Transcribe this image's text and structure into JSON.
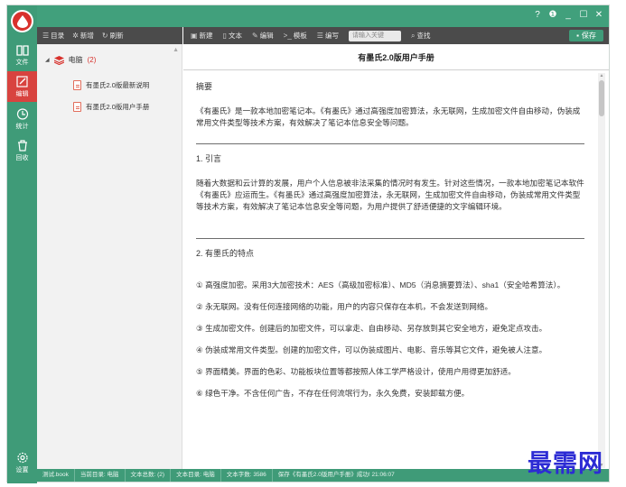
{
  "window": {
    "controls": [
      "?",
      "❶",
      "_",
      "☐",
      "✕"
    ]
  },
  "rail": {
    "items": [
      {
        "label": "文件",
        "icon": "book-icon"
      },
      {
        "label": "编辑",
        "icon": "edit-icon",
        "active": true
      },
      {
        "label": "统计",
        "icon": "clock-icon"
      },
      {
        "label": "回收",
        "icon": "trash-icon"
      }
    ],
    "settings_label": "设置"
  },
  "tree_toolbar": {
    "catalog": "目录",
    "add": "新增",
    "refresh": "刷新"
  },
  "editor_toolbar": {
    "new": "新建",
    "text": "文本",
    "edit": "编辑",
    "template": "模板",
    "format": "编写",
    "search_placeholder": "请输入关键",
    "find": "查找",
    "save": "保存"
  },
  "tree": {
    "root_label": "电脑",
    "root_count": "(2)",
    "nodes": [
      "有墨氏2.0版最新说明",
      "有墨氏2.0版用户手册"
    ]
  },
  "document": {
    "title": "有墨氏2.0版用户手册",
    "heading_abstract": "摘要",
    "abstract": "《有墨氏》是一款本地加密笔记本。《有墨氏》通过高强度加密算法，永无联网，生成加密文件自由移动，伪装成常用文件类型等技术方案，有效解决了笔记本信息安全等问题。",
    "heading_intro": "1. 引言",
    "intro": "随着大数据和云计算的发展，用户个人信息被非法采集的情况时有发生。针对这些情况，一款本地加密笔记本软件《有墨氏》应运而生。《有墨氏》通过高强度加密算法，永无联网，生成加密文件自由移动，伪装成常用文件类型等技术方案，有效解决了笔记本信息安全等问题，为用户提供了舒适便捷的文字编辑环境。",
    "heading_features": "2. 有墨氏的特点",
    "features": [
      "① 高强度加密。采用3大加密技术：AES（高级加密标准）、MD5（消息摘要算法）、sha1（安全哈希算法）。",
      "② 永无联网。没有任何连接网络的功能，用户的内容只保存在本机，不会发送到网络。",
      "③ 生成加密文件。创建后的加密文件，可以拿走、自由移动、另存放到其它安全地方，避免定点攻击。",
      "④ 伪装成常用文件类型。创建的加密文件，可以伪装成图片、电影、音乐等其它文件，避免被人注意。",
      "⑤ 界面精美。界面的色彩、功能板块位置等都按照人体工学严格设计，使用户用得更加舒适。",
      "⑥ 绿色干净。不含任何广告，不存在任何流氓行为，永久免费，安装卸载方便。"
    ]
  },
  "statusbar": [
    "测试.book",
    "当前目录: 电脑",
    "文本总数: (2)",
    "文本目录: 电脑",
    "文本字数: 3586",
    "保存《有墨氏2.0版用户手册》成功! 21:06:07"
  ],
  "watermark": "最需网",
  "colors": {
    "brand_green": "#3f9b78",
    "active_red": "#d8433f",
    "dark_toolbar": "#4b4b4b"
  }
}
